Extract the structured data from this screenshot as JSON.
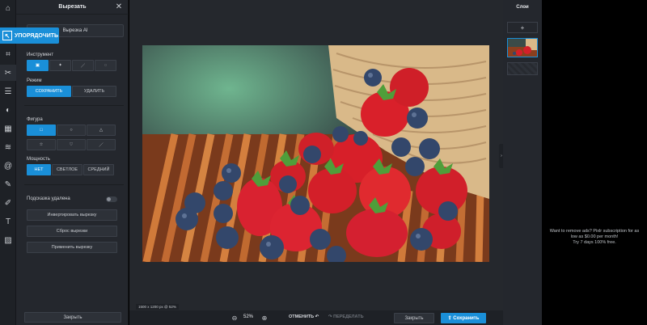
{
  "panel": {
    "title": "Вырезать",
    "mode_value": "Вырезка AI",
    "arrange_label": "УПОРЯДОЧИТЬ",
    "tool_label": "Инструмент",
    "mode_label": "Режим",
    "mode_keep": "СОХРАНИТЬ",
    "mode_remove": "УДАЛИТЬ",
    "shape_label": "Фигура",
    "power_label": "Мощность",
    "power_none": "НЕТ",
    "power_light": "СВЕТЛОЕ",
    "power_medium": "СРЕДНИЙ",
    "hint_label": "Подсказка удалена",
    "invert_btn": "Инвертировать вырезку",
    "reset_btn": "Сброс вырезки",
    "apply_btn": "Применить вырезку",
    "close_btn": "Закрыть"
  },
  "canvas": {
    "size_info": "1500 x 1200 px @ 52%"
  },
  "bottom": {
    "zoom": "52%",
    "undo": "ОТМЕНИТЬ",
    "redo": "ПЕРЕДЕЛАТЬ",
    "close": "Закрыть",
    "save": "Сохранить"
  },
  "layers": {
    "title": "Слои",
    "add": "+"
  },
  "ad": {
    "line1": "Want to remove ads? Pixlr subscription for as",
    "line2": "low as $0.00 per month!",
    "line3": "Try 7 days 100% free."
  },
  "colors": {
    "accent": "#1a8fd8",
    "panel_bg": "#24272d",
    "canvas_bg": "#25282d"
  }
}
